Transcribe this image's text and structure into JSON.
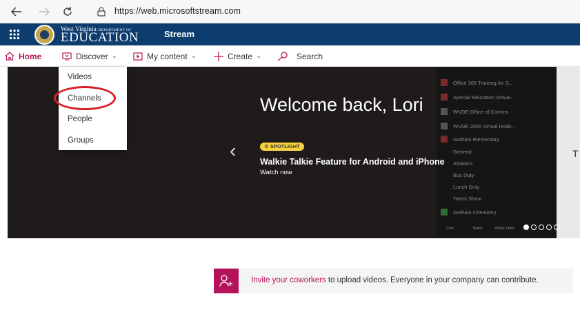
{
  "browser": {
    "url": "https://web.microsoftstream.com"
  },
  "header": {
    "logo_top": "West Virginia",
    "logo_top_small": "DEPARTMENT OF",
    "logo_main": "EDUCATION",
    "app_name": "Stream",
    "color": "#0c3d6e"
  },
  "nav": {
    "home": "Home",
    "discover": "Discover",
    "my_content": "My content",
    "create": "Create",
    "search": "Search",
    "accent": "#b4125b"
  },
  "discover_menu": {
    "items": [
      "Videos",
      "Channels",
      "People",
      "Groups"
    ],
    "highlighted": "Channels"
  },
  "hero": {
    "welcome": "Welcome back, Lori",
    "badge": "SPOTLIGHT",
    "title": "Walkie Talkie Feature for Android and iPhone",
    "subtitle": "Watch now",
    "right_letter": "T",
    "panel_items": [
      "Office 365 Training for S...",
      "Special Education Virtual...",
      "WVDE Office of Comms",
      "WVDE 2020 Virtual Holid...",
      "Gotham Elementary",
      "General",
      "Athletics",
      "Bus Duty",
      "Lunch Duty",
      "Talent Show",
      "Gotham Chemistry"
    ],
    "panel_bottom": [
      "Chat",
      "Teams",
      "Walkie Talkie"
    ],
    "slides": 5,
    "active_slide": 1
  },
  "invite": {
    "link_text": "Invite your coworkers",
    "rest_text": " to upload videos. Everyone in your company can contribute."
  },
  "icons": [
    "back-icon",
    "forward-icon",
    "refresh-icon",
    "lock-icon",
    "waffle-icon",
    "home-icon",
    "discover-icon",
    "my-content-icon",
    "create-icon",
    "search-icon",
    "add-person-icon"
  ]
}
